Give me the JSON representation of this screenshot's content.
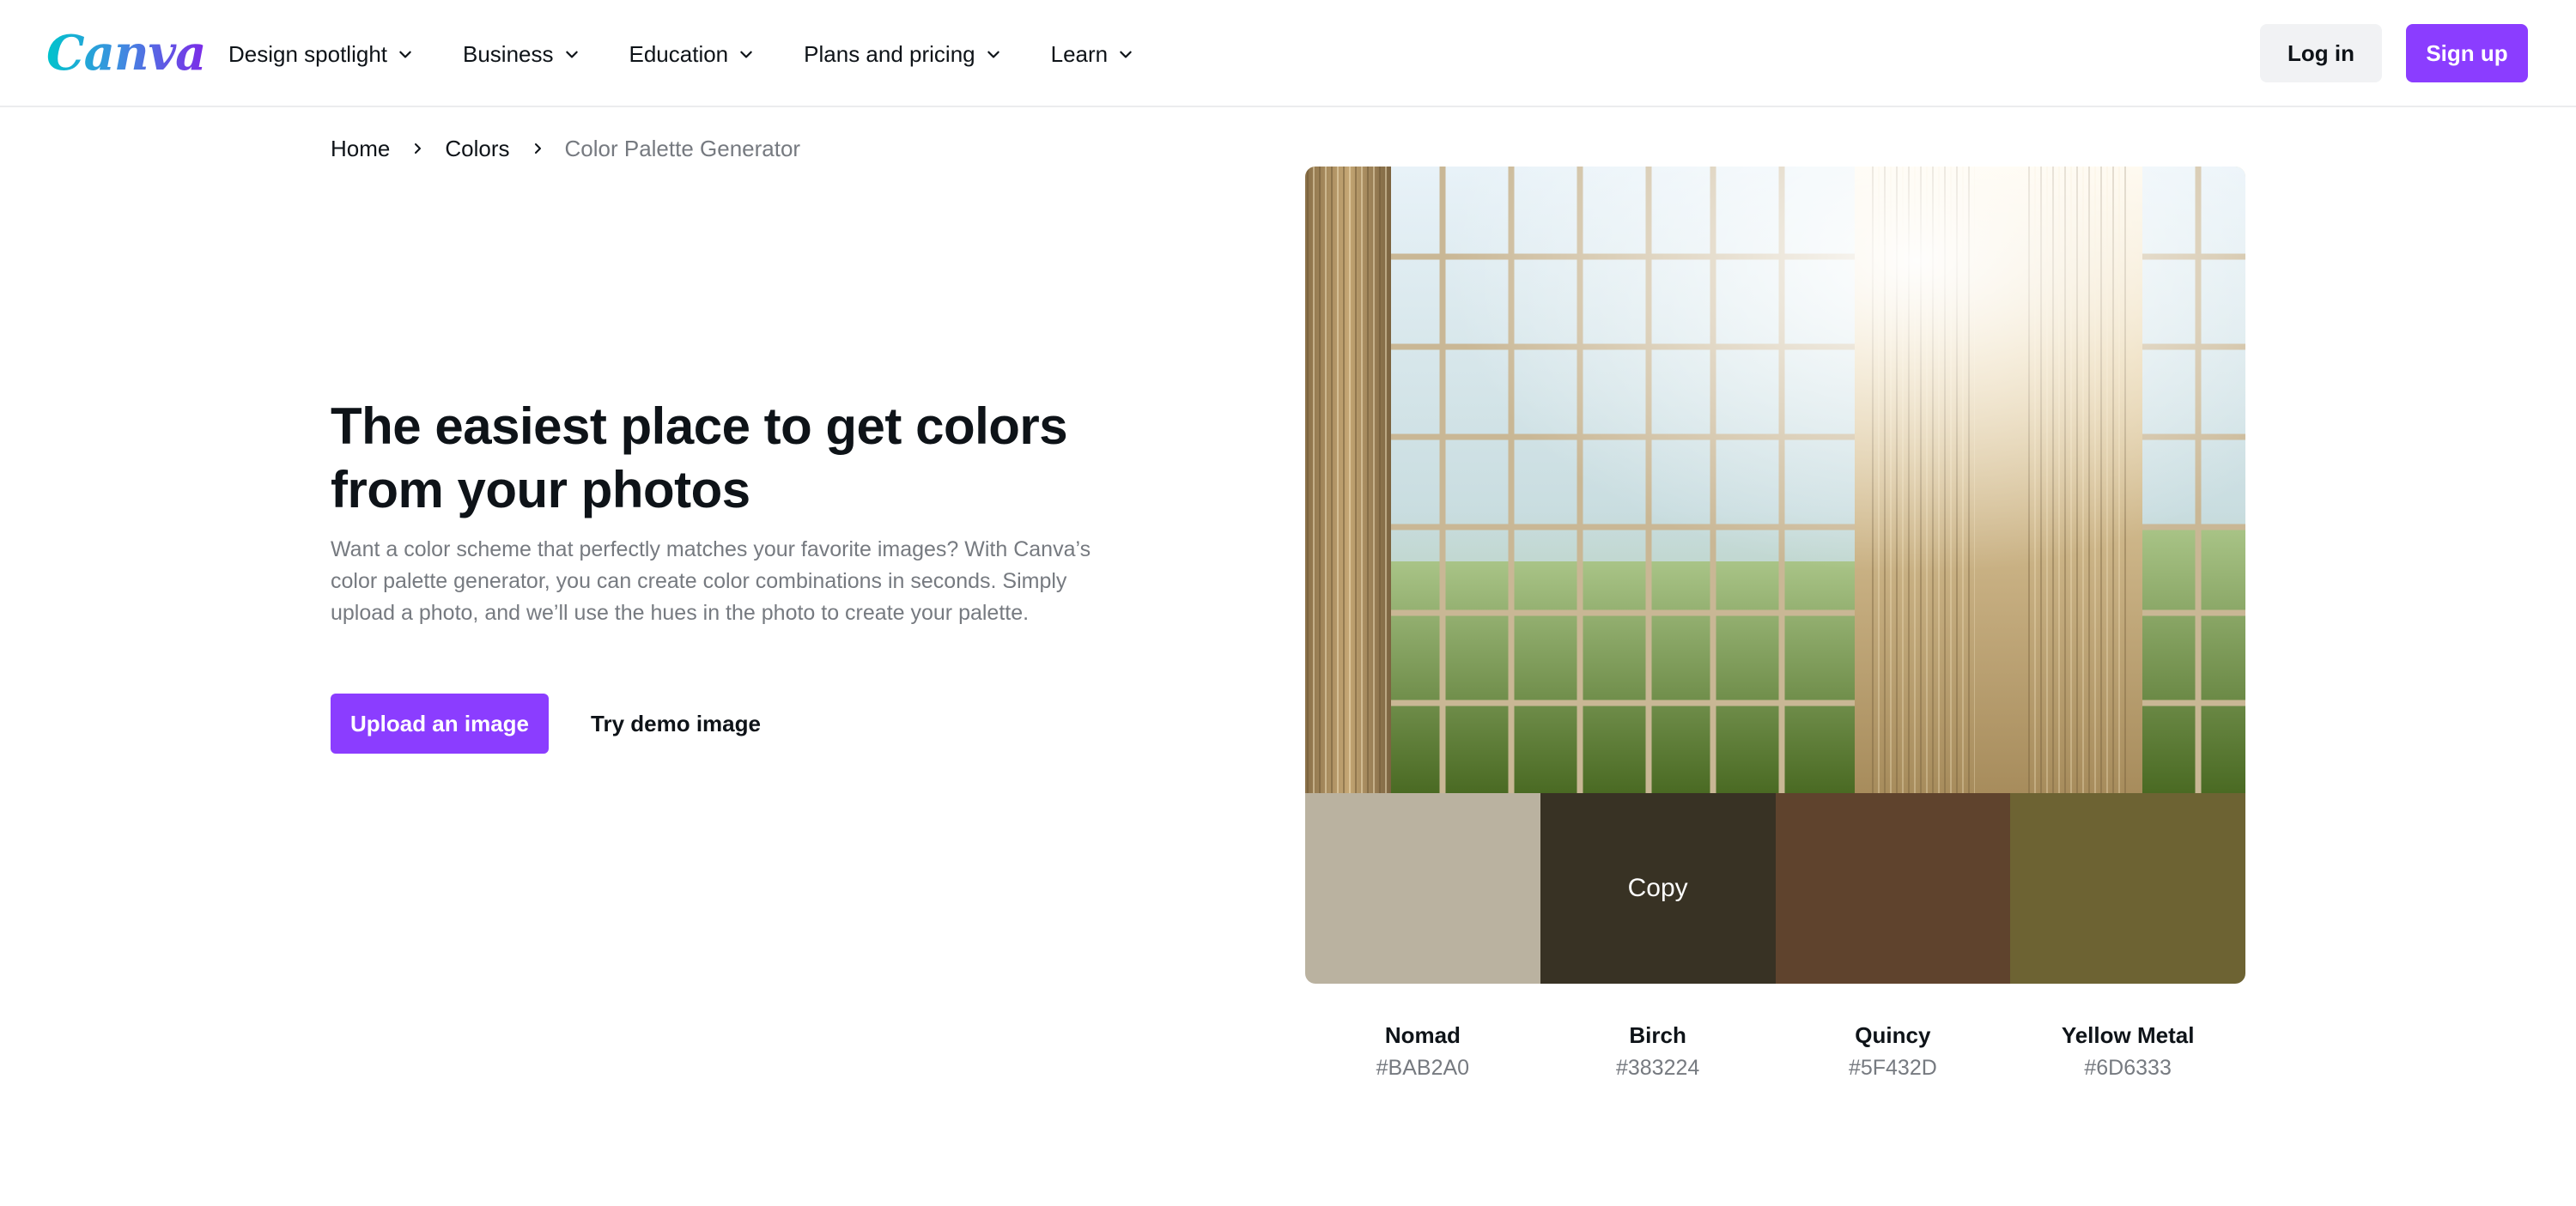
{
  "header": {
    "logo": "Canva",
    "nav": [
      {
        "label": "Design spotlight"
      },
      {
        "label": "Business"
      },
      {
        "label": "Education"
      },
      {
        "label": "Plans and pricing"
      },
      {
        "label": "Learn"
      }
    ],
    "login_label": "Log in",
    "signup_label": "Sign up",
    "accent": "#8b3dff"
  },
  "breadcrumb": {
    "items": [
      "Home",
      "Colors",
      "Color Palette Generator"
    ]
  },
  "hero": {
    "title": "The easiest place to get colors from your photos",
    "description": "Want a color scheme that perfectly matches your favorite images? With Canva’s color palette generator, you can create color combinations in seconds. Simply upload a photo, and we’ll use the hues in the photo to create your palette.",
    "upload_label": "Upload an image",
    "demo_label": "Try demo image"
  },
  "palette": {
    "copy_label": "Copy",
    "colors": [
      {
        "name": "Nomad",
        "hex": "#BAB2A0"
      },
      {
        "name": "Birch",
        "hex": "#383224"
      },
      {
        "name": "Quincy",
        "hex": "#5F432D"
      },
      {
        "name": "Yellow Metal",
        "hex": "#6D6333"
      }
    ]
  }
}
